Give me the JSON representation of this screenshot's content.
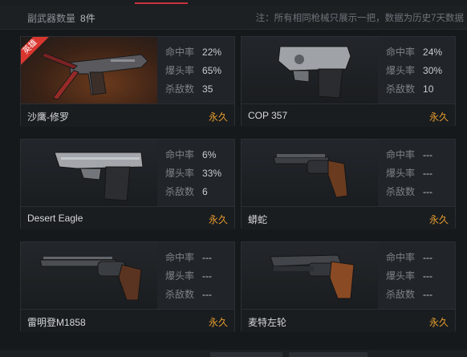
{
  "header": {
    "count_label": "副武器数量",
    "count_value": "8件",
    "note": "注：所有相同枪械只展示一把，数据为历史7天数据"
  },
  "stat_labels": {
    "hit": "命中率",
    "headshot": "爆头率",
    "kills": "杀敌数"
  },
  "weapons": [
    {
      "name": "沙鹰-修罗",
      "hit": "22%",
      "headshot": "65%",
      "kills": "35",
      "status": "永久",
      "badge": "英雄",
      "icon": "desert-eagle-shura-pistol-icon"
    },
    {
      "name": "COP 357",
      "hit": "24%",
      "headshot": "30%",
      "kills": "10",
      "status": "永久",
      "icon": "cop-357-pistol-icon"
    },
    {
      "name": "Desert Eagle",
      "hit": "6%",
      "headshot": "33%",
      "kills": "6",
      "status": "永久",
      "icon": "desert-eagle-pistol-icon"
    },
    {
      "name": "蟒蛇",
      "hit": "---",
      "headshot": "---",
      "kills": "---",
      "status": "永久",
      "icon": "python-revolver-icon"
    },
    {
      "name": "雷明登M1858",
      "hit": "---",
      "headshot": "---",
      "kills": "---",
      "status": "永久",
      "icon": "remington-1858-revolver-icon"
    },
    {
      "name": "麦特左轮",
      "hit": "---",
      "headshot": "---",
      "kills": "---",
      "status": "永久",
      "icon": "mateba-revolver-icon"
    }
  ],
  "colors": {
    "permanent": "#e59a2c",
    "badge": "#d8362f",
    "accent": "#c8323a"
  }
}
